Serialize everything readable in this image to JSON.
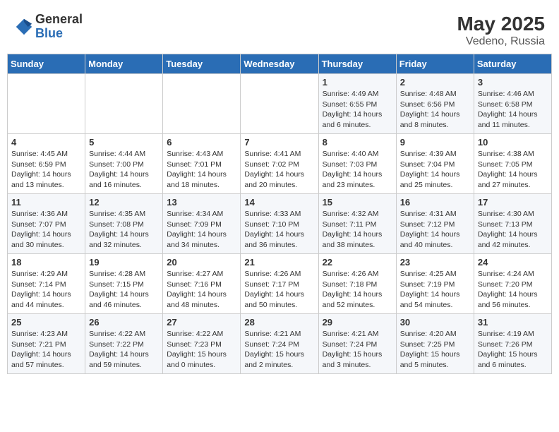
{
  "header": {
    "logo_general": "General",
    "logo_blue": "Blue",
    "title": "May 2025",
    "location": "Vedeno, Russia"
  },
  "days_of_week": [
    "Sunday",
    "Monday",
    "Tuesday",
    "Wednesday",
    "Thursday",
    "Friday",
    "Saturday"
  ],
  "weeks": [
    [
      {
        "day": "",
        "info": ""
      },
      {
        "day": "",
        "info": ""
      },
      {
        "day": "",
        "info": ""
      },
      {
        "day": "",
        "info": ""
      },
      {
        "day": "1",
        "info": "Sunrise: 4:49 AM\nSunset: 6:55 PM\nDaylight: 14 hours\nand 6 minutes."
      },
      {
        "day": "2",
        "info": "Sunrise: 4:48 AM\nSunset: 6:56 PM\nDaylight: 14 hours\nand 8 minutes."
      },
      {
        "day": "3",
        "info": "Sunrise: 4:46 AM\nSunset: 6:58 PM\nDaylight: 14 hours\nand 11 minutes."
      }
    ],
    [
      {
        "day": "4",
        "info": "Sunrise: 4:45 AM\nSunset: 6:59 PM\nDaylight: 14 hours\nand 13 minutes."
      },
      {
        "day": "5",
        "info": "Sunrise: 4:44 AM\nSunset: 7:00 PM\nDaylight: 14 hours\nand 16 minutes."
      },
      {
        "day": "6",
        "info": "Sunrise: 4:43 AM\nSunset: 7:01 PM\nDaylight: 14 hours\nand 18 minutes."
      },
      {
        "day": "7",
        "info": "Sunrise: 4:41 AM\nSunset: 7:02 PM\nDaylight: 14 hours\nand 20 minutes."
      },
      {
        "day": "8",
        "info": "Sunrise: 4:40 AM\nSunset: 7:03 PM\nDaylight: 14 hours\nand 23 minutes."
      },
      {
        "day": "9",
        "info": "Sunrise: 4:39 AM\nSunset: 7:04 PM\nDaylight: 14 hours\nand 25 minutes."
      },
      {
        "day": "10",
        "info": "Sunrise: 4:38 AM\nSunset: 7:05 PM\nDaylight: 14 hours\nand 27 minutes."
      }
    ],
    [
      {
        "day": "11",
        "info": "Sunrise: 4:36 AM\nSunset: 7:07 PM\nDaylight: 14 hours\nand 30 minutes."
      },
      {
        "day": "12",
        "info": "Sunrise: 4:35 AM\nSunset: 7:08 PM\nDaylight: 14 hours\nand 32 minutes."
      },
      {
        "day": "13",
        "info": "Sunrise: 4:34 AM\nSunset: 7:09 PM\nDaylight: 14 hours\nand 34 minutes."
      },
      {
        "day": "14",
        "info": "Sunrise: 4:33 AM\nSunset: 7:10 PM\nDaylight: 14 hours\nand 36 minutes."
      },
      {
        "day": "15",
        "info": "Sunrise: 4:32 AM\nSunset: 7:11 PM\nDaylight: 14 hours\nand 38 minutes."
      },
      {
        "day": "16",
        "info": "Sunrise: 4:31 AM\nSunset: 7:12 PM\nDaylight: 14 hours\nand 40 minutes."
      },
      {
        "day": "17",
        "info": "Sunrise: 4:30 AM\nSunset: 7:13 PM\nDaylight: 14 hours\nand 42 minutes."
      }
    ],
    [
      {
        "day": "18",
        "info": "Sunrise: 4:29 AM\nSunset: 7:14 PM\nDaylight: 14 hours\nand 44 minutes."
      },
      {
        "day": "19",
        "info": "Sunrise: 4:28 AM\nSunset: 7:15 PM\nDaylight: 14 hours\nand 46 minutes."
      },
      {
        "day": "20",
        "info": "Sunrise: 4:27 AM\nSunset: 7:16 PM\nDaylight: 14 hours\nand 48 minutes."
      },
      {
        "day": "21",
        "info": "Sunrise: 4:26 AM\nSunset: 7:17 PM\nDaylight: 14 hours\nand 50 minutes."
      },
      {
        "day": "22",
        "info": "Sunrise: 4:26 AM\nSunset: 7:18 PM\nDaylight: 14 hours\nand 52 minutes."
      },
      {
        "day": "23",
        "info": "Sunrise: 4:25 AM\nSunset: 7:19 PM\nDaylight: 14 hours\nand 54 minutes."
      },
      {
        "day": "24",
        "info": "Sunrise: 4:24 AM\nSunset: 7:20 PM\nDaylight: 14 hours\nand 56 minutes."
      }
    ],
    [
      {
        "day": "25",
        "info": "Sunrise: 4:23 AM\nSunset: 7:21 PM\nDaylight: 14 hours\nand 57 minutes."
      },
      {
        "day": "26",
        "info": "Sunrise: 4:22 AM\nSunset: 7:22 PM\nDaylight: 14 hours\nand 59 minutes."
      },
      {
        "day": "27",
        "info": "Sunrise: 4:22 AM\nSunset: 7:23 PM\nDaylight: 15 hours\nand 0 minutes."
      },
      {
        "day": "28",
        "info": "Sunrise: 4:21 AM\nSunset: 7:24 PM\nDaylight: 15 hours\nand 2 minutes."
      },
      {
        "day": "29",
        "info": "Sunrise: 4:21 AM\nSunset: 7:24 PM\nDaylight: 15 hours\nand 3 minutes."
      },
      {
        "day": "30",
        "info": "Sunrise: 4:20 AM\nSunset: 7:25 PM\nDaylight: 15 hours\nand 5 minutes."
      },
      {
        "day": "31",
        "info": "Sunrise: 4:19 AM\nSunset: 7:26 PM\nDaylight: 15 hours\nand 6 minutes."
      }
    ]
  ]
}
